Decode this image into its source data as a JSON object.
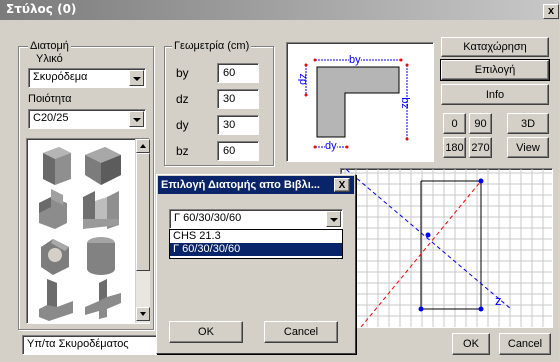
{
  "window": {
    "title": "Στύλος (0)",
    "close": "x"
  },
  "section": {
    "group_label": "Διατομή",
    "material_label": "Υλικό",
    "material_value": "Σκυρόδεμα",
    "quality_label": "Ποιότητα",
    "quality_value": "C20/25",
    "library_value": "Υπ/τα Σκυροδέματος"
  },
  "geometry": {
    "group_label": "Γεωμετρία (cm)",
    "fields": [
      {
        "label": "by",
        "value": "60"
      },
      {
        "label": "dz",
        "value": "30"
      },
      {
        "label": "dy",
        "value": "30"
      },
      {
        "label": "bz",
        "value": "60"
      }
    ]
  },
  "preview": {
    "by": "by",
    "dz": "dz",
    "bz": "bz",
    "dy": "dy"
  },
  "actions": {
    "register": "Καταχώρηση",
    "select": "Επιλογή",
    "info": "Info",
    "rot0": "0",
    "rot90": "90",
    "view3d": "3D",
    "rot180": "180",
    "rot270": "270",
    "view": "View"
  },
  "axes": {
    "z": "z"
  },
  "bottom": {
    "ok": "OK",
    "cancel": "Cancel"
  },
  "dialog": {
    "title": "Επιλογή Διατομής απο Βιβλι...",
    "close": "X",
    "selected": "Γ 60/30/30/60",
    "options": [
      "CHS 21.3",
      "Γ 60/30/30/60"
    ],
    "ok": "OK",
    "cancel": "Cancel"
  },
  "shapes": [
    "column-block",
    "L-section",
    "T-section",
    "U-section",
    "ring-section",
    "round-section",
    "angle-section",
    "cross-section",
    "channel-section",
    "tee-beam"
  ],
  "colors": {
    "title_dark": "#7b7b7b",
    "dialog_title": "#0a246a",
    "grid_blue": "#0000ff",
    "axis_red": "#ff0000"
  }
}
